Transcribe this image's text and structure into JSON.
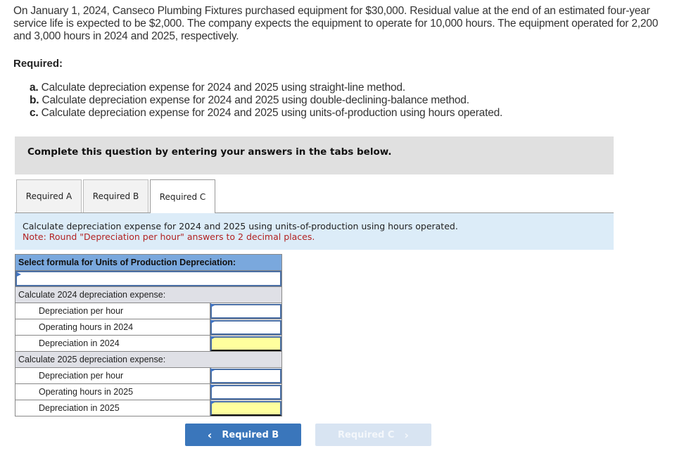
{
  "problem": {
    "text": "On January 1, 2024, Canseco Plumbing Fixtures purchased equipment for $30,000. Residual value at the end of an estimated four-year service life is expected to be $2,000. The company expects the equipment to operate for 10,000 hours. The equipment operated for 2,200 and 3,000 hours in 2024 and 2025, respectively."
  },
  "required": {
    "label": "Required:",
    "items": [
      {
        "letter": "a.",
        "text": "Calculate depreciation expense for 2024 and 2025 using straight-line method."
      },
      {
        "letter": "b.",
        "text": "Calculate depreciation expense for 2024 and 2025 using double-declining-balance method."
      },
      {
        "letter": "c.",
        "text": "Calculate depreciation expense for 2024 and 2025 using units-of-production using hours operated."
      }
    ]
  },
  "instruction": "Complete this question by entering your answers in the tabs below.",
  "tabs": [
    {
      "label": "Required A",
      "active": false
    },
    {
      "label": "Required B",
      "active": false
    },
    {
      "label": "Required C",
      "active": true
    }
  ],
  "panel": {
    "description": "Calculate depreciation expense for 2024 and 2025 using units-of-production using hours operated.",
    "note": "Note: Round \"Depreciation per hour\" answers to 2 decimal places."
  },
  "grid": {
    "header": "Select formula for Units of Production Depreciation:",
    "formula_value": "",
    "sections": [
      {
        "title": "Calculate 2024 depreciation expense:",
        "rows": [
          {
            "label": "Depreciation per hour",
            "value": ""
          },
          {
            "label": "Operating hours in 2024",
            "value": ""
          },
          {
            "label": "Depreciation in 2024",
            "value": ""
          }
        ]
      },
      {
        "title": "Calculate 2025 depreciation expense:",
        "rows": [
          {
            "label": "Depreciation per hour",
            "value": ""
          },
          {
            "label": "Operating hours in 2025",
            "value": ""
          },
          {
            "label": "Depreciation in 2025",
            "value": ""
          }
        ]
      }
    ]
  },
  "nav": {
    "prev_label": "Required B",
    "next_label": "Required C",
    "prev_icon": "chevron-left-icon",
    "next_icon": "chevron-right-icon"
  },
  "colors": {
    "header_blue": "#7aa8dd",
    "button_blue": "#3a76bb",
    "note_red": "#b22222",
    "total_yellow": "#ffff9e"
  }
}
